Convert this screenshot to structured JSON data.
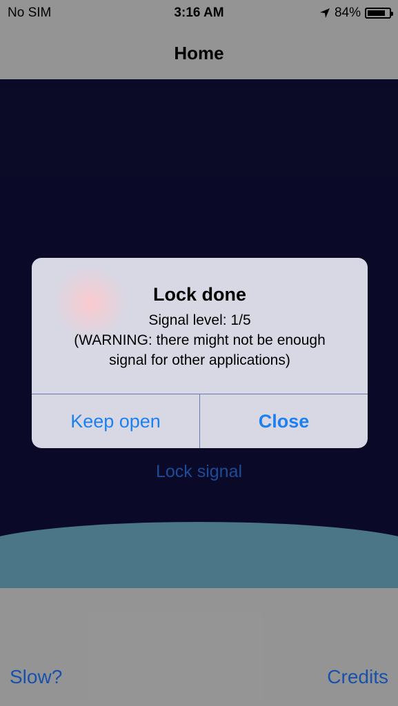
{
  "status_bar": {
    "carrier": "No SIM",
    "time": "3:16 AM",
    "battery_percent": "84%",
    "battery_level": 0.84,
    "location_icon": "location-arrow-icon"
  },
  "nav": {
    "title": "Home"
  },
  "scene": {
    "lock_signal_label": "Lock signal"
  },
  "bottom": {
    "slow_label": "Slow?",
    "credits_label": "Credits"
  },
  "alert": {
    "title": "Lock done",
    "message_line1": "Signal level: 1/5",
    "message_line2": "(WARNING: there might not be enough",
    "message_line3": "signal for other applications)",
    "keep_open_label": "Keep open",
    "close_label": "Close"
  },
  "colors": {
    "accent": "#1e80f0",
    "scene_background": "#0b0b2a",
    "wave": "#4e7b8d",
    "bars": "#9b9b9b"
  }
}
